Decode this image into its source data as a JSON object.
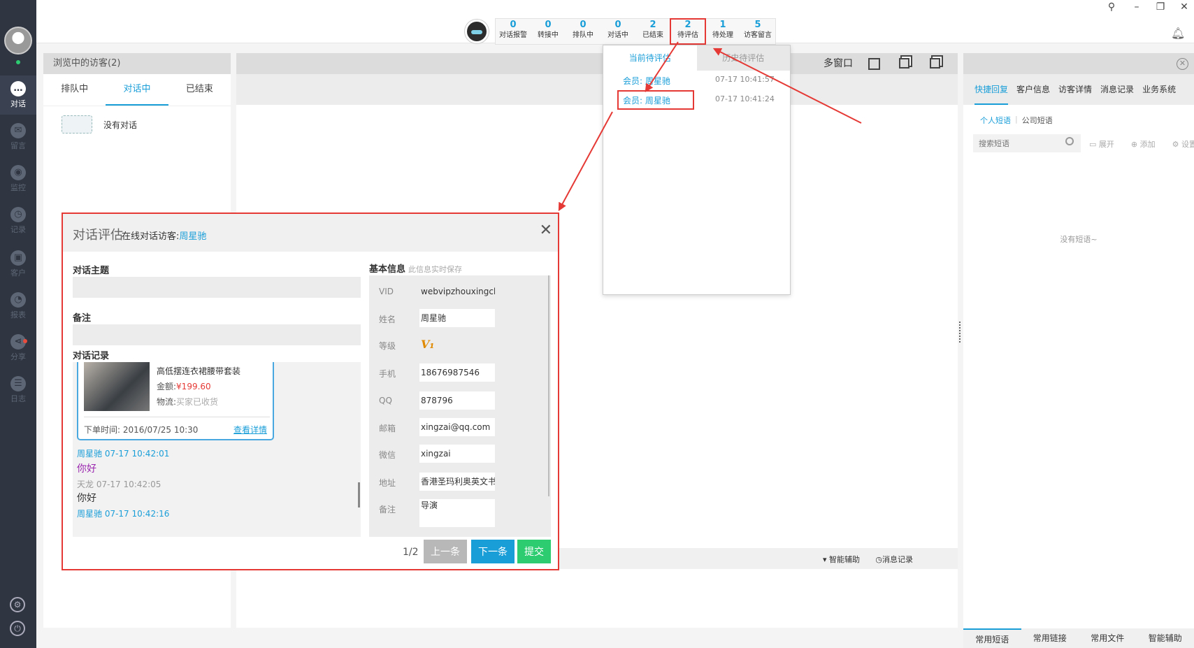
{
  "sidebar": {
    "items": [
      {
        "label": "对话",
        "icon": "chat-icon",
        "glyph": "…"
      },
      {
        "label": "留言",
        "icon": "envelope-icon",
        "glyph": "✉"
      },
      {
        "label": "监控",
        "icon": "eye-icon",
        "glyph": "◉"
      },
      {
        "label": "记录",
        "icon": "clock-icon",
        "glyph": "◷"
      },
      {
        "label": "客户",
        "icon": "contact-card-icon",
        "glyph": "▣"
      },
      {
        "label": "报表",
        "icon": "pie-chart-icon",
        "glyph": "◔"
      },
      {
        "label": "分享",
        "icon": "share-icon",
        "glyph": "⋖"
      },
      {
        "label": "日志",
        "icon": "clipboard-icon",
        "glyph": "☰"
      }
    ]
  },
  "topbar": {
    "stats": [
      {
        "num": "0",
        "label": "对话报警"
      },
      {
        "num": "0",
        "label": "转接中"
      },
      {
        "num": "0",
        "label": "排队中"
      },
      {
        "num": "0",
        "label": "对话中"
      },
      {
        "num": "2",
        "label": "已结束"
      },
      {
        "num": "2",
        "label": "待评估"
      },
      {
        "num": "1",
        "label": "待处理"
      },
      {
        "num": "5",
        "label": "访客留言"
      }
    ]
  },
  "visitors": {
    "header": "浏览中的访客(2)",
    "tabs": [
      "排队中",
      "对话中",
      "已结束"
    ],
    "empty_text": "没有对话"
  },
  "middle": {
    "multiwin_label": "多窗口",
    "smart_assist": "▾ 智能辅助",
    "message_record": "◷消息记录"
  },
  "right": {
    "tabs": [
      "快捷回复",
      "客户信息",
      "访客详情",
      "消息记录",
      "业务系统"
    ],
    "sub_tabs": [
      "个人短语",
      "公司短语"
    ],
    "search_placeholder": "搜索短语",
    "tools": [
      "展开",
      "添加",
      "设置"
    ],
    "empty_text": "没有短语~",
    "footer_tabs": [
      "常用短语",
      "常用链接",
      "常用文件",
      "智能辅助"
    ]
  },
  "pending": {
    "tabs": [
      "当前待评估",
      "历史待评估"
    ],
    "rows": [
      {
        "member": "会员: 周星驰",
        "time": "07-17 10:41:57"
      },
      {
        "member": "会员: 周星驰",
        "time": "07-17 10:41:24"
      }
    ]
  },
  "dialog": {
    "title": "对话评估",
    "subtitle_prefix": "在线对话访客:",
    "visitor_name": "周星驰",
    "topic_label": "对话主题",
    "note_label": "备注",
    "record_label": "对话记录",
    "order": {
      "title": "高低摆连衣裙腰带套装",
      "amount_label": "金额:",
      "amount_value": "¥199.60",
      "logistics_label": "物流:",
      "logistics_value": "买家已收货",
      "order_time": "下单时间: 2016/07/25 10:30",
      "detail_link": "查看详情"
    },
    "messages": [
      {
        "text": "周星驰   07-17 10:42:01",
        "style": "blue"
      },
      {
        "text": "你好",
        "style": "purple"
      },
      {
        "text": "天龙   07-17 10:42:05",
        "style": "gray"
      },
      {
        "text": "你好",
        "style": "dark"
      },
      {
        "text": "周星驰   07-17 10:42:16",
        "style": "blue"
      }
    ],
    "info_title": "基本信息",
    "info_hint": "此信息实时保存",
    "info": [
      {
        "key": "VID",
        "value": "webvipzhouxingchi"
      },
      {
        "key": "姓名",
        "value": "周星驰"
      },
      {
        "key": "等级",
        "value": "V₁"
      },
      {
        "key": "手机",
        "value": "18676987546"
      },
      {
        "key": "QQ",
        "value": "878796"
      },
      {
        "key": "邮箱",
        "value": "xingzai@qq.com"
      },
      {
        "key": "微信",
        "value": "xingzai"
      },
      {
        "key": "地址",
        "value": "香港圣玛利奥英文书院"
      },
      {
        "key": "备注",
        "value": "导演"
      }
    ],
    "pager": "1/2",
    "prev_label": "上一条",
    "next_label": "下一条",
    "submit_label": "提交"
  },
  "colors": {
    "accent": "#1a9ed8",
    "annotation": "#e53935",
    "sidebar_bg": "#2f3541",
    "submit": "#2ecc71"
  }
}
